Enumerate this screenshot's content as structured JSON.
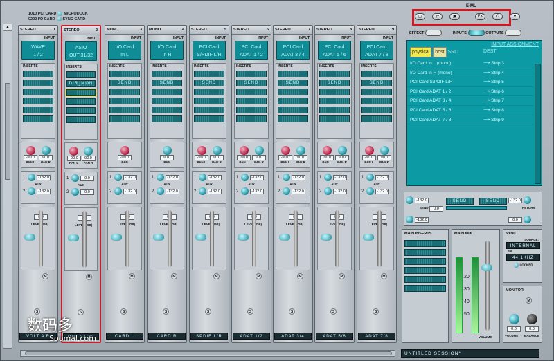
{
  "header": {
    "card1": "1010 PCI CARD",
    "card2": "0202 I/O CARD",
    "dock1": "MICRODOCK",
    "dock2": "SYNC CARD",
    "brand": "E-MU"
  },
  "top_buttons": [
    "▢",
    "⇄",
    "▣",
    "FX",
    "O",
    "▼"
  ],
  "toggles": {
    "effect": "EFFECT",
    "inputs": "INPUTS",
    "outputs": "OUTPUTS"
  },
  "strips": [
    {
      "type": "STEREO",
      "num": "1",
      "input": [
        "WAVE",
        "1 / 2"
      ],
      "inserts": [
        "",
        "",
        "",
        "",
        "",
        ""
      ],
      "knobs": [
        "red",
        "teal"
      ],
      "vals": [
        "-90.0",
        "90.0"
      ],
      "caps": [
        "PAN L",
        "PAN R"
      ],
      "aux": [
        "-132.0",
        "-132.0"
      ],
      "level": "0.0",
      "name": "VOLT A R"
    },
    {
      "type": "STEREO",
      "num": "2",
      "input": [
        "ASIO",
        "OUT 31/32"
      ],
      "inserts": [
        "",
        "DIR_MON",
        "",
        "",
        "",
        ""
      ],
      "knobs": [
        "red",
        "teal"
      ],
      "vals": [
        "-90.0",
        "90.0"
      ],
      "caps": [
        "PAN L",
        "PAN R"
      ],
      "aux": [
        "0.0",
        "0.0"
      ],
      "level": "0.0",
      "name": "OUT 31/32"
    },
    {
      "type": "MONO",
      "num": "3",
      "input": [
        "I/O Card",
        "In L"
      ],
      "inserts": [
        "",
        "SEND",
        "",
        "",
        "",
        ""
      ],
      "knobs": [
        "red"
      ],
      "vals": [
        "-90.0"
      ],
      "caps": [
        "PAN"
      ],
      "aux": [
        "-132.0",
        "-132.0"
      ],
      "level": "0.0",
      "name": "CARD L"
    },
    {
      "type": "MONO",
      "num": "4",
      "input": [
        "I/O Card",
        "In R"
      ],
      "inserts": [
        "",
        "SEND",
        "",
        "",
        "",
        ""
      ],
      "knobs": [
        "teal"
      ],
      "vals": [
        "90.0"
      ],
      "caps": [
        "PAN"
      ],
      "aux": [
        "-132.0",
        "-132.0"
      ],
      "level": "0.0",
      "name": "CARD R"
    },
    {
      "type": "STEREO",
      "num": "5",
      "input": [
        "PCI Card",
        "S/PDIF L/R"
      ],
      "inserts": [
        "",
        "SEND",
        "",
        "",
        "",
        ""
      ],
      "knobs": [
        "red",
        "teal"
      ],
      "vals": [
        "-90.0",
        "90.0"
      ],
      "caps": [
        "PAN L",
        "PAN R"
      ],
      "aux": [
        "-132.0",
        "-132.0"
      ],
      "level": "0.0",
      "name": "SPDIF L/R"
    },
    {
      "type": "STEREO",
      "num": "6",
      "input": [
        "PCI Card",
        "ADAT 1 / 2"
      ],
      "inserts": [
        "",
        "SEND",
        "",
        "",
        "",
        ""
      ],
      "knobs": [
        "red",
        "teal"
      ],
      "vals": [
        "-90.0",
        "90.0"
      ],
      "caps": [
        "PAN L",
        "PAN R"
      ],
      "aux": [
        "-132.0",
        "-132.0"
      ],
      "level": "0.0",
      "name": "ADAT 1/2"
    },
    {
      "type": "STEREO",
      "num": "7",
      "input": [
        "PCI Card",
        "ADAT 3 / 4"
      ],
      "inserts": [
        "",
        "SEND",
        "",
        "",
        "",
        ""
      ],
      "knobs": [
        "red",
        "teal"
      ],
      "vals": [
        "-90.0",
        "90.0"
      ],
      "caps": [
        "PAN L",
        "PAN R"
      ],
      "aux": [
        "-132.0",
        "-132.0"
      ],
      "level": "0.0",
      "name": "ADAT 3/4"
    },
    {
      "type": "STEREO",
      "num": "8",
      "input": [
        "PCI Card",
        "ADAT 5 / 6"
      ],
      "inserts": [
        "",
        "SEND",
        "",
        "",
        "",
        ""
      ],
      "knobs": [
        "red",
        "teal"
      ],
      "vals": [
        "-90.0",
        "90.0"
      ],
      "caps": [
        "PAN L",
        "PAN R"
      ],
      "aux": [
        "-132.0",
        "-132.0"
      ],
      "level": "0.0",
      "name": "ADAT 5/6"
    },
    {
      "type": "STEREO",
      "num": "9",
      "input": [
        "PCI Card",
        "ADAT 7 / 8"
      ],
      "inserts": [
        "",
        "SEND",
        "",
        "",
        "",
        ""
      ],
      "knobs": [
        "red",
        "teal"
      ],
      "vals": [
        "-90.0",
        "90.0"
      ],
      "caps": [
        "PAN L",
        "PAN R"
      ],
      "aux": [
        "-132.0",
        "-132.0"
      ],
      "level": "0.0",
      "name": "ADAT 7/8"
    }
  ],
  "labels": {
    "input": "INPUT",
    "inserts": "INSERTS",
    "aux": "AUX",
    "level": "LEVEL (DB)",
    "mono_tag": "MIC",
    "mute": "M",
    "solo": "S",
    "main_inserts": "MAIN INSERTS",
    "main_mix": "MAIN MIX",
    "volume": "VOLUME",
    "sync": "SYNC",
    "source": "SOURCE:",
    "source_val": "INTERNAL",
    "sr": "SR",
    "sr_val": "44.1KHZ",
    "locked": "LOCKED",
    "monitor": "MONITOR",
    "balance": "BALANCE",
    "send": "SEND",
    "return": "RETURN"
  },
  "assignment": {
    "title": "INPUT ASSIGNMENT",
    "physical": "physical",
    "host": "host",
    "src": "SRC",
    "dest": "DEST",
    "rows": [
      [
        "I/O Card In L (mono)",
        "Strip 3"
      ],
      [
        "I/O Card In R (mono)",
        "Strip 4"
      ],
      [
        "PCI Card S/PDIF L/R",
        "Strip 5"
      ],
      [
        "PCI Card ADAT 1 / 2",
        "Strip 6"
      ],
      [
        "PCI Card ADAT 3 / 4",
        "Strip 7"
      ],
      [
        "PCI Card ADAT 5 / 6",
        "Strip 8"
      ],
      [
        "PCI Card ADAT 7 / 8",
        "Strip 9"
      ]
    ]
  },
  "fx": {
    "send_l": "-132.0",
    "send_r": "-132.0",
    "return_l": "-132.0",
    "return_r": "0.0",
    "send_lcd1": "SEND",
    "send_lcd2": "SEND",
    "send_val": "0.0"
  },
  "mainmix": {
    "scale": [
      "-30",
      "-20",
      "-10",
      "0"
    ],
    "ticks": [
      "20",
      "30",
      "40",
      "50"
    ]
  },
  "monitor": {
    "volume": "0.0",
    "balance": "0.0"
  },
  "status": "UNTITLED SESSION*",
  "watermark": {
    "cn": "数码多",
    "en": "Soomal.com"
  }
}
